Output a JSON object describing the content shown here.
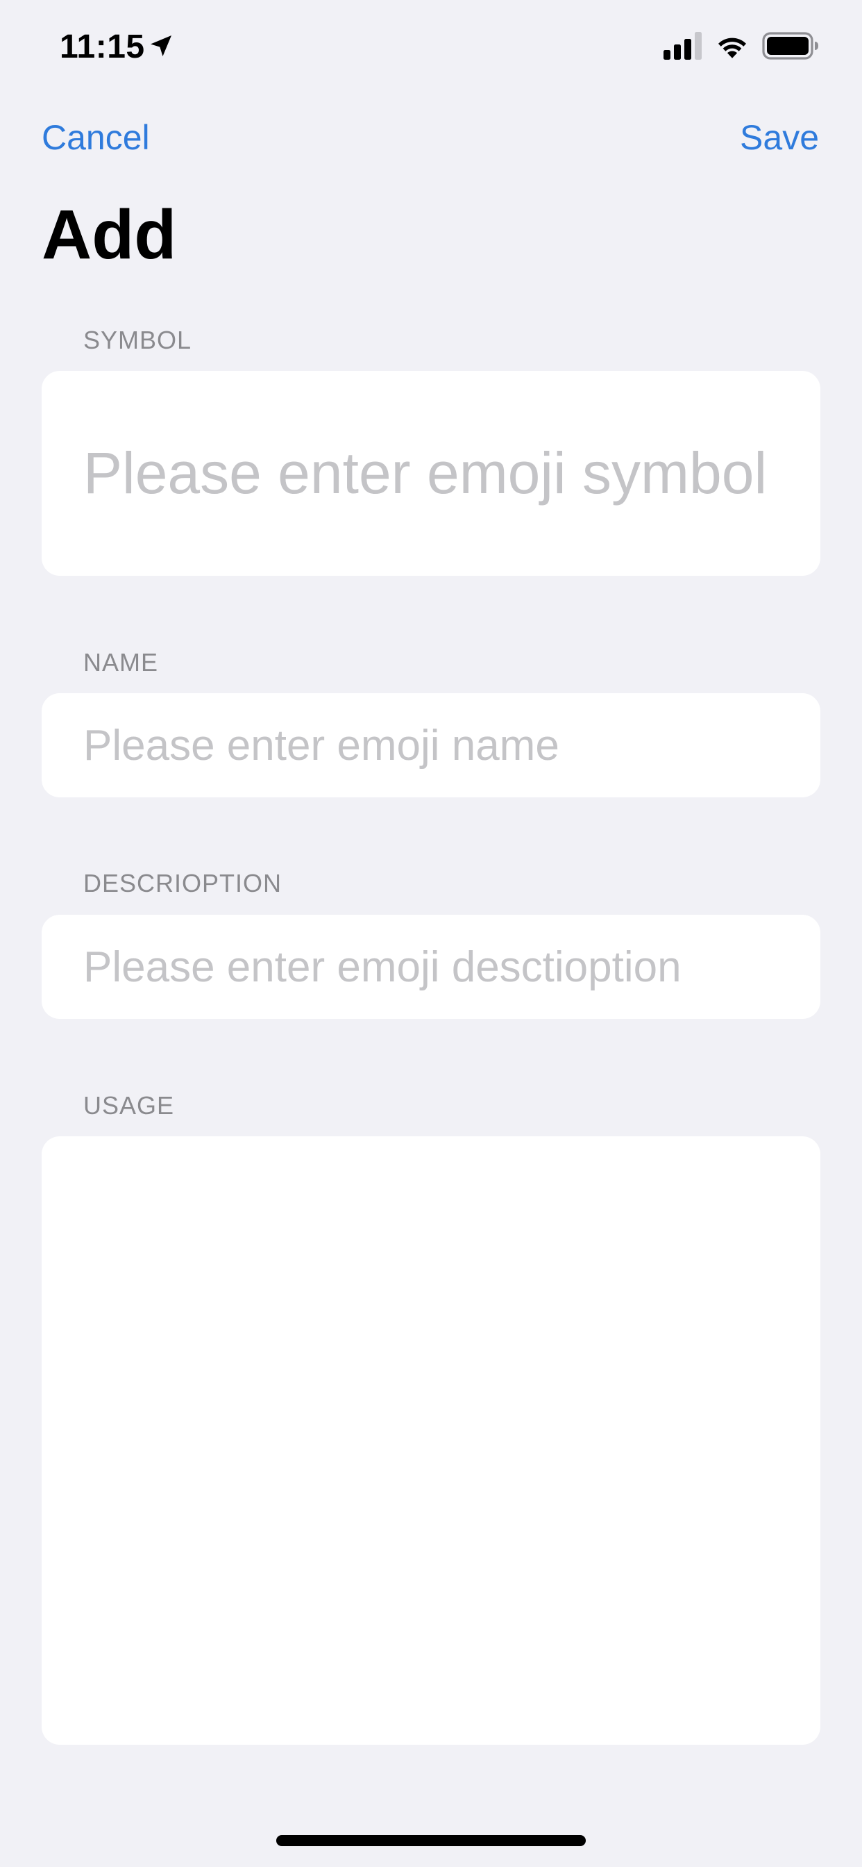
{
  "status_bar": {
    "time": "11:15"
  },
  "nav": {
    "cancel_label": "Cancel",
    "save_label": "Save",
    "title": "Add"
  },
  "form": {
    "symbol": {
      "header": "SYMBOL",
      "placeholder": "Please enter emoji symbol",
      "value": ""
    },
    "name": {
      "header": "NAME",
      "placeholder": "Please enter emoji name",
      "value": ""
    },
    "description": {
      "header": "DESCRIOPTION",
      "placeholder": "Please enter emoji desctioption",
      "value": ""
    },
    "usage": {
      "header": "USAGE",
      "value": ""
    }
  },
  "colors": {
    "accent": "#2f7bdc",
    "background": "#f1f1f6",
    "card": "#ffffff",
    "section_header": "#8a8a8e",
    "placeholder": "#c4c4c7"
  },
  "icons": [
    "location-arrow-icon",
    "cellular-signal-icon",
    "wifi-icon",
    "battery-icon"
  ]
}
